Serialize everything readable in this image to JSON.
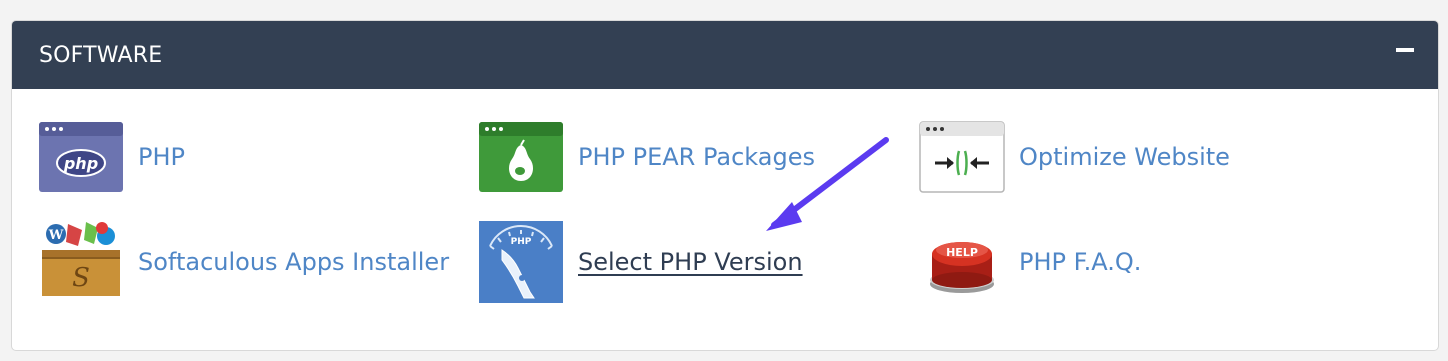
{
  "panel": {
    "title": "SOFTWARE",
    "collapse_icon": "minus-icon"
  },
  "items": [
    {
      "label": "PHP",
      "icon": "php-icon"
    },
    {
      "label": "PHP PEAR Packages",
      "icon": "php-pear-icon"
    },
    {
      "label": "Optimize Website",
      "icon": "optimize-website-icon"
    },
    {
      "label": "Softaculous Apps Installer",
      "icon": "softaculous-icon"
    },
    {
      "label": "Select PHP Version",
      "icon": "select-php-version-icon"
    },
    {
      "label": "PHP F.A.Q.",
      "icon": "help-button-icon"
    }
  ],
  "colors": {
    "header_bg": "#334053",
    "link": "#4f86c6",
    "active_link": "#2f3d52",
    "arrow": "#5b3bf0"
  }
}
